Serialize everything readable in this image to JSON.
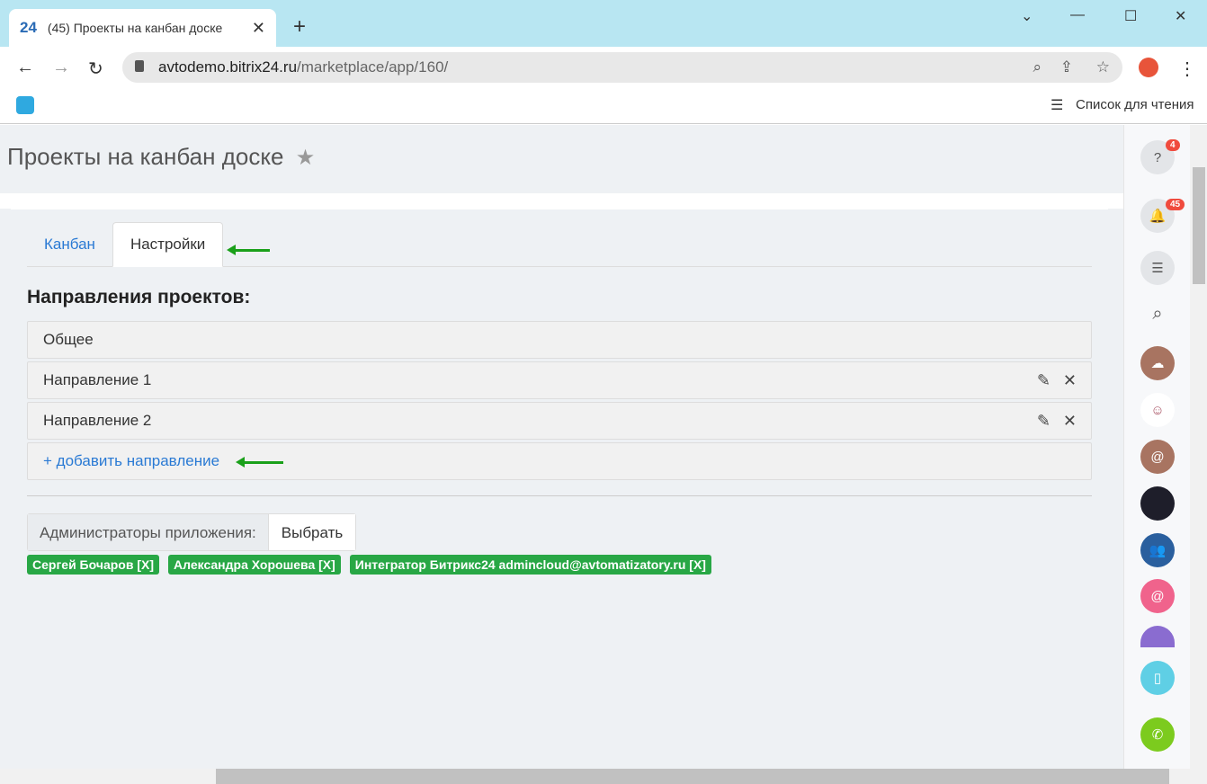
{
  "browser": {
    "tab_title": "(45) Проекты на канбан доске",
    "tab_logo": "24",
    "url_host": "avtodemo.bitrix24.ru",
    "url_path": "/marketplace/app/160/",
    "reading_list": "Список для чтения"
  },
  "page": {
    "title": "Проекты на канбан доске",
    "tabs": [
      {
        "label": "Канбан"
      },
      {
        "label": "Настройки"
      }
    ],
    "section_title": "Направления проектов:",
    "directions": [
      {
        "label": "Общее"
      },
      {
        "label": "Направление 1"
      },
      {
        "label": "Направление 2"
      }
    ],
    "add_direction": "+ добавить направление",
    "admins_label": "Администраторы приложения:",
    "select_button": "Выбрать",
    "admins": [
      {
        "label": "Сергей Бочаров [X]"
      },
      {
        "label": "Александра Хорошева [X]"
      },
      {
        "label": "Интегратор Битрикс24 admincloud@avtomatizatory.ru [X]"
      }
    ]
  },
  "sidebar": {
    "help_badge": "4",
    "notifications_badge": "45"
  },
  "colors": {
    "accent_green": "#28a745",
    "link": "#2a7ad4",
    "arrow": "#1aa01a"
  }
}
